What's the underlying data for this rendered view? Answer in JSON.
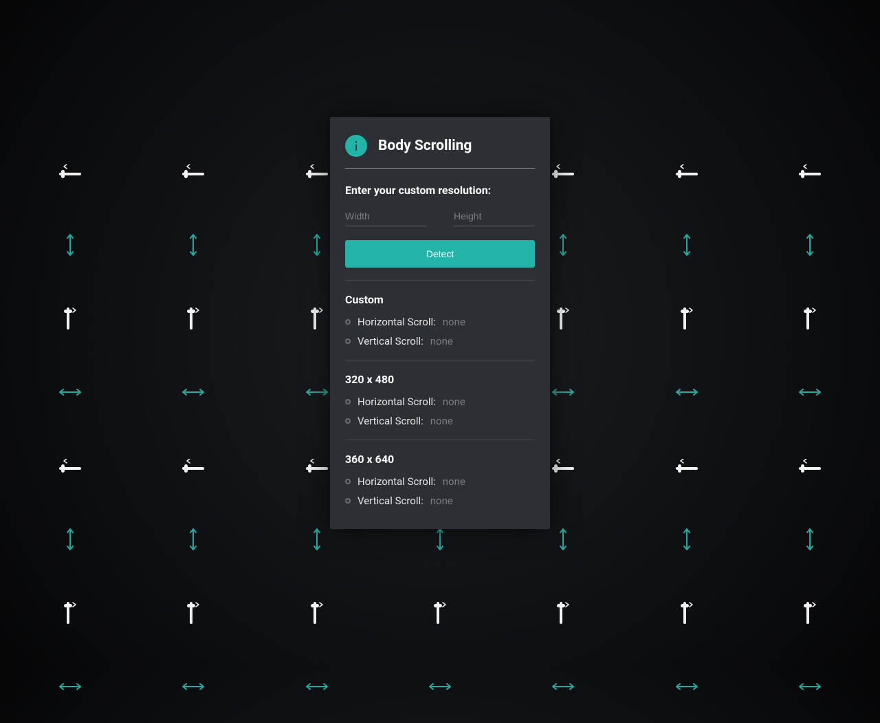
{
  "header": {
    "title": "Body Scrolling",
    "icon": "info-icon"
  },
  "form": {
    "subtitle": "Enter your custom resolution:",
    "width_placeholder": "Width",
    "height_placeholder": "Height",
    "detect_button": "Detect"
  },
  "sections": [
    {
      "title": "Custom",
      "hscroll_label": "Horizontal Scroll:",
      "hscroll_value": "none",
      "vscroll_label": "Vertical Scroll:",
      "vscroll_value": "none"
    },
    {
      "title": "320 x 480",
      "hscroll_label": "Horizontal Scroll:",
      "hscroll_value": "none",
      "vscroll_label": "Vertical Scroll:",
      "vscroll_value": "none"
    },
    {
      "title": "360 x 640",
      "hscroll_label": "Horizontal Scroll:",
      "hscroll_value": "none",
      "vscroll_label": "Vertical Scroll:",
      "vscroll_value": "none"
    }
  ],
  "background_icons": [
    "slider-h",
    "slider-h",
    "slider-h",
    "slider-h",
    "slider-h",
    "slider-h",
    "slider-h",
    "arrow-v",
    "arrow-v",
    "arrow-v",
    "arrow-v",
    "arrow-v",
    "arrow-v",
    "arrow-v",
    "slider-v",
    "slider-v",
    "slider-v",
    "slider-v",
    "slider-v",
    "slider-v",
    "slider-v",
    "arrow-h",
    "arrow-h",
    "arrow-h",
    "arrow-h",
    "arrow-h",
    "arrow-h",
    "arrow-h",
    "slider-h",
    "slider-h",
    "slider-h",
    "slider-h",
    "slider-h",
    "slider-h",
    "slider-h",
    "arrow-v",
    "arrow-v",
    "arrow-v",
    "arrow-v",
    "arrow-v",
    "arrow-v",
    "arrow-v",
    "slider-v",
    "slider-v",
    "slider-v",
    "slider-v",
    "slider-v",
    "slider-v",
    "slider-v",
    "arrow-h",
    "arrow-h",
    "arrow-h",
    "arrow-h",
    "arrow-h",
    "arrow-h",
    "arrow-h"
  ]
}
